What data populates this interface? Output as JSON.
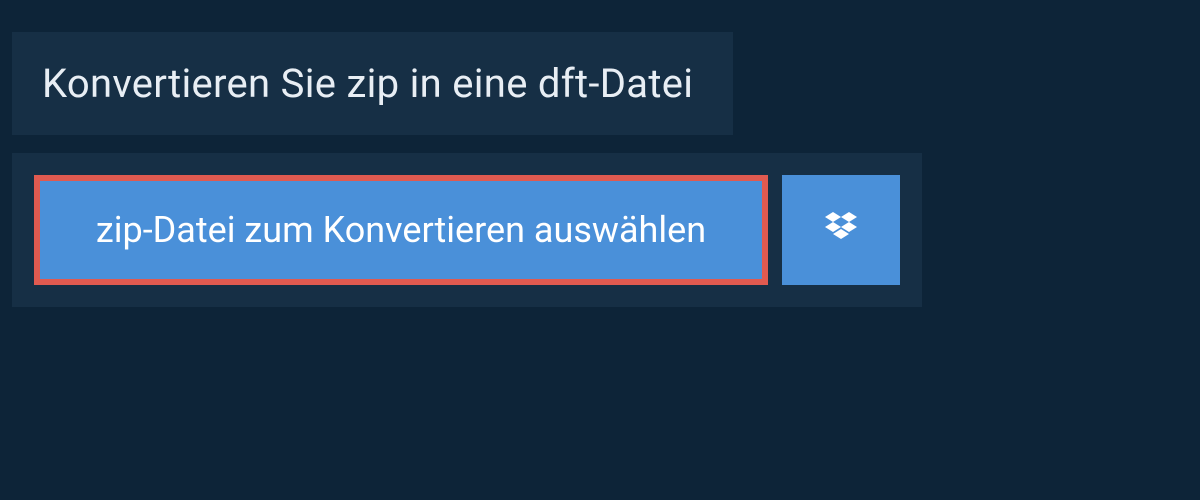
{
  "header": {
    "title": "Konvertieren Sie zip in eine dft-Datei"
  },
  "upload": {
    "select_button_label": "zip-Datei zum Konvertieren auswählen",
    "dropbox_icon": "dropbox-icon"
  },
  "colors": {
    "background": "#0d2438",
    "panel": "#162f45",
    "button": "#4a90d9",
    "highlight_border": "#e05a50",
    "text_light": "#e8eef4",
    "text_white": "#ffffff"
  }
}
